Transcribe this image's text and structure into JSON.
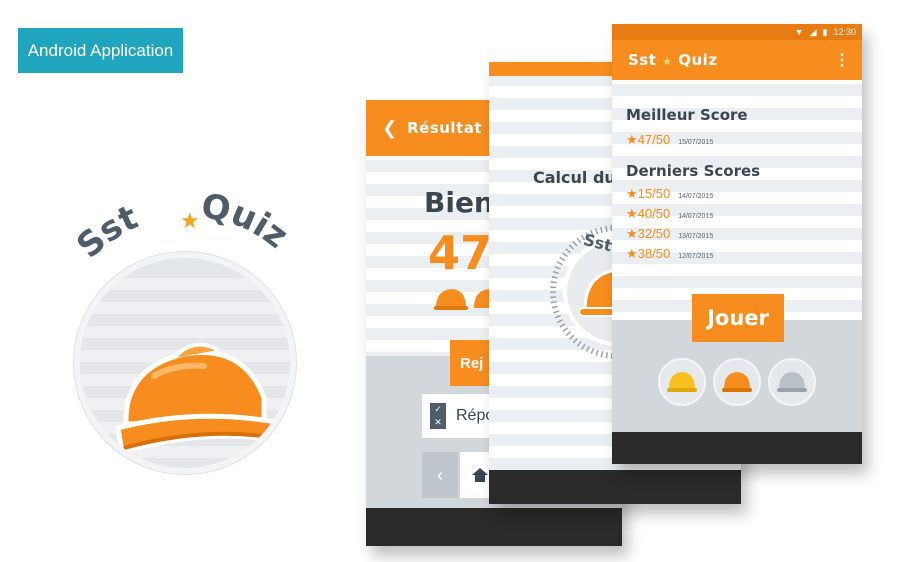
{
  "tag": {
    "label": "Android Application"
  },
  "logo": {
    "left": "Sst",
    "star": "★",
    "right": "Quiz"
  },
  "colors": {
    "orange": "#f68d1e",
    "teal": "#1fa5bd",
    "dark": "#3a4651",
    "grey": "#d2d7dc"
  },
  "result_screen": {
    "back_icon": "chevron-left-icon",
    "title": "Résultat",
    "heading": "Bien",
    "score": "47/",
    "replay_label": "Rej",
    "answers_label": "Répo",
    "prev_icon": "chevron-left-icon",
    "home_icon": "home-icon"
  },
  "calc_screen": {
    "heading": "Calcul du",
    "dial_label": "Sst"
  },
  "home_screen": {
    "status": {
      "time": "12:30"
    },
    "app_title_left": "Sst",
    "app_title_star": "★",
    "app_title_right": "Quiz",
    "menu_icon": "more-vert-icon",
    "best_title": "Meilleur Score",
    "best": {
      "value": "47/50",
      "date": "15/07/2015"
    },
    "recent_title": "Derniers Scores",
    "recent": [
      {
        "value": "15/50",
        "date": "14/07/2015"
      },
      {
        "value": "40/50",
        "date": "14/07/2015"
      },
      {
        "value": "32/50",
        "date": "13/07/2015"
      },
      {
        "value": "38/50",
        "date": "12/07/2015"
      }
    ],
    "play_label": "Jouer",
    "helmet_levels": [
      "gold-helmet-icon",
      "orange-helmet-icon",
      "silver-helmet-icon"
    ]
  }
}
